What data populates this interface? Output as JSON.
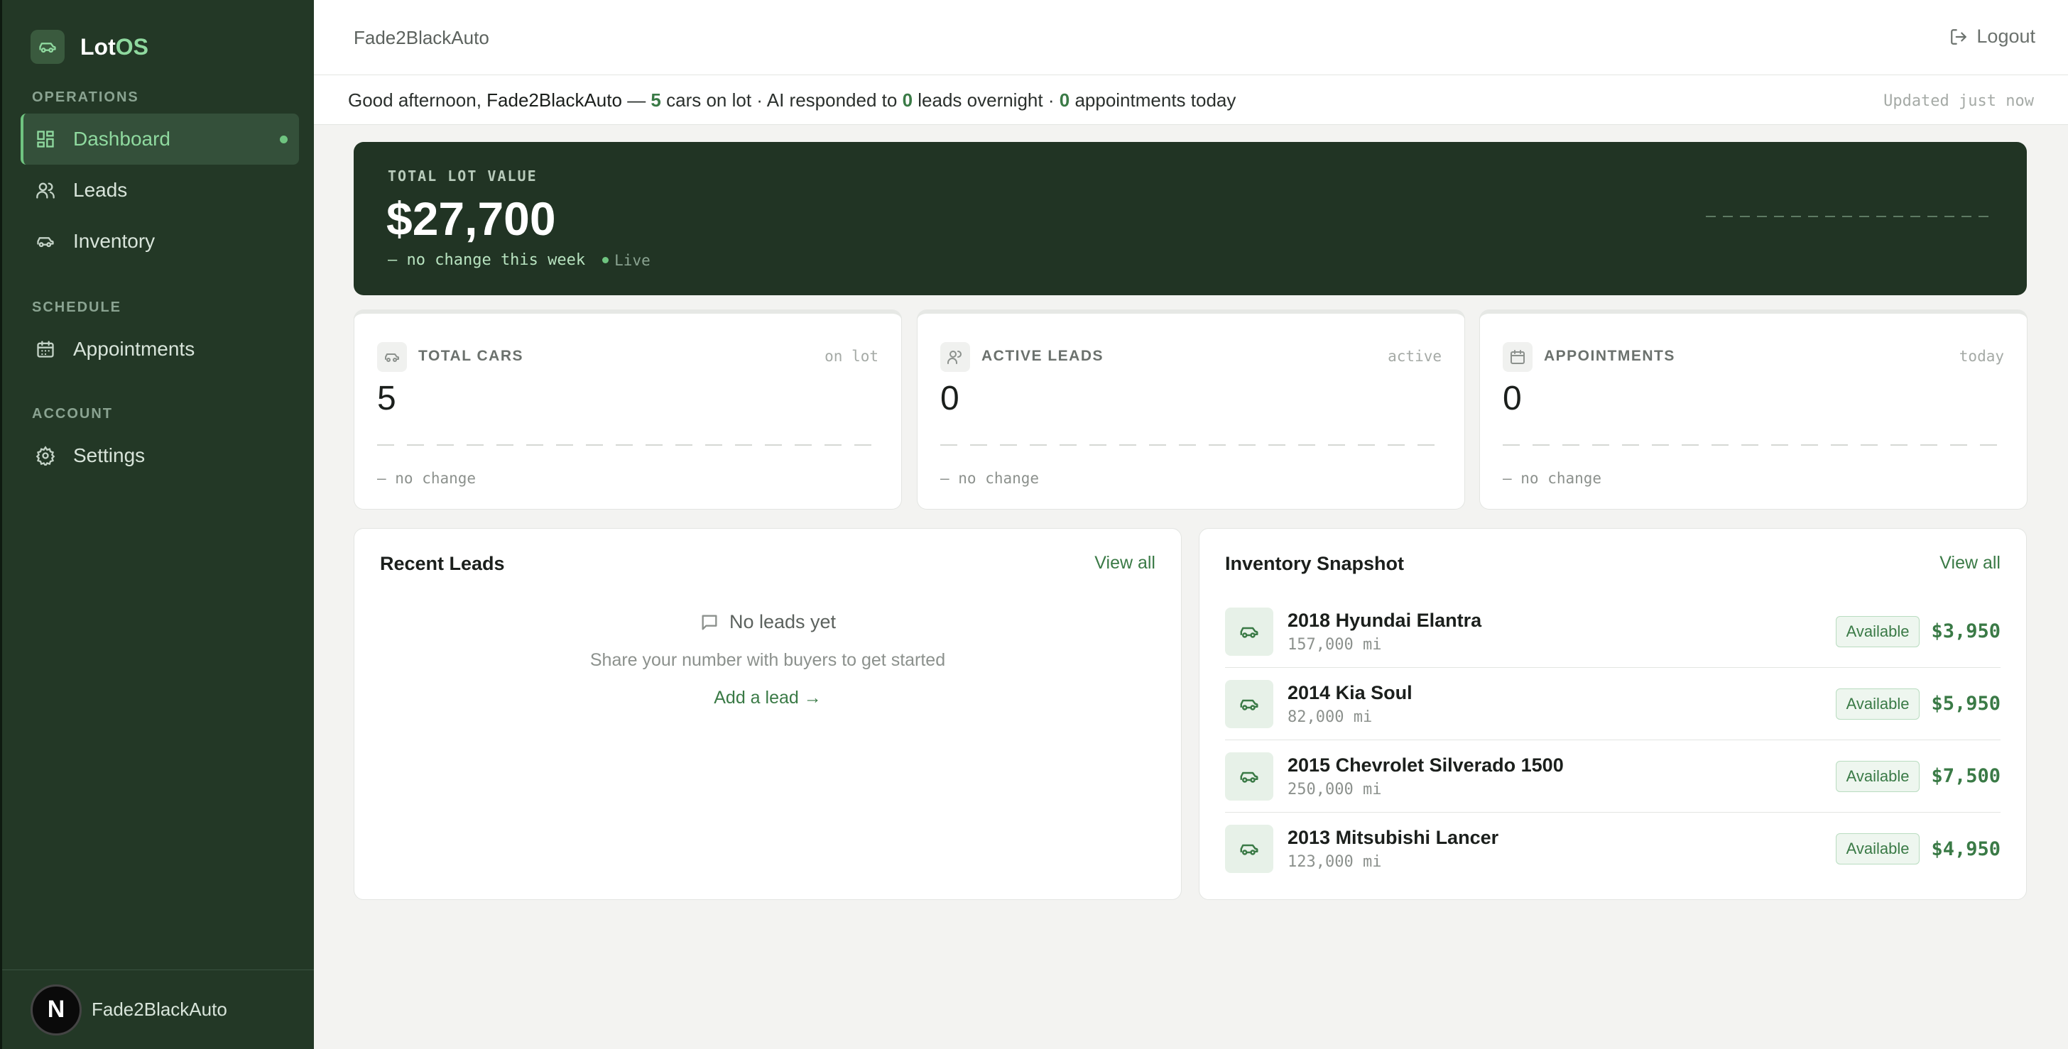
{
  "sidebar": {
    "brand_prefix": "Lot",
    "brand_suffix": "OS",
    "sections": {
      "operations": "OPERATIONS",
      "schedule": "SCHEDULE",
      "account": "ACCOUNT"
    },
    "items": {
      "dashboard": "Dashboard",
      "leads": "Leads",
      "inventory": "Inventory",
      "appointments": "Appointments",
      "settings": "Settings"
    },
    "user": {
      "initial": "N",
      "name": "Fade2BlackAuto"
    }
  },
  "header": {
    "title": "Fade2BlackAuto",
    "logout": "Logout"
  },
  "greeting": {
    "prefix": "Good afternoon,",
    "name": "Fade2BlackAuto",
    "dash": "—",
    "cars_count": "5",
    "cars_text": "cars on lot · AI responded to",
    "leads_count": "0",
    "leads_text": "leads overnight ·",
    "appts_count": "0",
    "appts_text": "appointments today",
    "updated": "Updated just now"
  },
  "hero": {
    "label": "TOTAL LOT VALUE",
    "value": "$27,700",
    "change": "— no change this week",
    "live": "Live"
  },
  "stats": [
    {
      "label": "TOTAL CARS",
      "tag": "on lot",
      "value": "5",
      "change": "— no change"
    },
    {
      "label": "ACTIVE LEADS",
      "tag": "active",
      "value": "0",
      "change": "— no change"
    },
    {
      "label": "APPOINTMENTS",
      "tag": "today",
      "value": "0",
      "change": "— no change"
    }
  ],
  "recent_leads": {
    "title": "Recent Leads",
    "view_all": "View all",
    "empty_title": "No leads yet",
    "empty_desc": "Share your number with buyers to get started",
    "add_lead": "Add a lead →"
  },
  "inventory": {
    "title": "Inventory Snapshot",
    "view_all": "View all",
    "items": [
      {
        "name": "2018 Hyundai Elantra",
        "miles": "157,000 mi",
        "status": "Available",
        "price": "$3,950"
      },
      {
        "name": "2014 Kia Soul",
        "miles": "82,000 mi",
        "status": "Available",
        "price": "$5,950"
      },
      {
        "name": "2015 Chevrolet Silverado 1500",
        "miles": "250,000 mi",
        "status": "Available",
        "price": "$7,500"
      },
      {
        "name": "2013 Mitsubishi Lancer",
        "miles": "123,000 mi",
        "status": "Available",
        "price": "$4,950"
      }
    ]
  }
}
